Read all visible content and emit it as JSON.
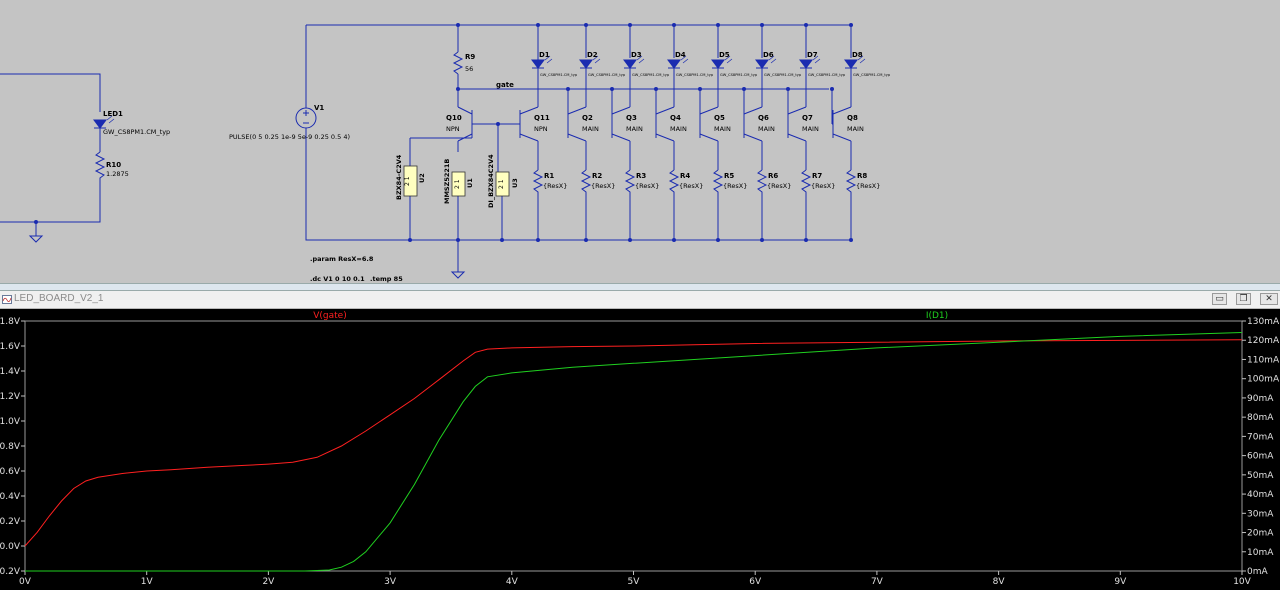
{
  "schematic": {
    "components": {
      "led1": {
        "ref": "LED1",
        "model": "GW_CS8PM1.CM_typ"
      },
      "r10": {
        "ref": "R10",
        "value": "1.2875"
      },
      "v1": {
        "ref": "V1",
        "value": "PULSE(0 5 0.25 1e-9 5e-9 0.25 0.5 4)"
      },
      "r9": {
        "ref": "R9",
        "value": "56"
      },
      "gate_label": "gate",
      "q10": {
        "ref": "Q10",
        "model": "NPN"
      },
      "q11": {
        "ref": "Q11",
        "model": "NPN"
      },
      "u2": {
        "ref": "U2",
        "model": "BZX84-C2V4",
        "pins": "2 1"
      },
      "u1": {
        "ref": "U1",
        "model": "MMSZ5221B",
        "pins": "2 1"
      },
      "u3": {
        "ref": "U3",
        "model": "DI_BZX84C2V4",
        "pins": "2 1"
      },
      "leds": [
        {
          "ref": "D1",
          "model": "GW_CS8PM1.CM_typ"
        },
        {
          "ref": "D2",
          "model": "GW_CS8PM1.CM_typ"
        },
        {
          "ref": "D3",
          "model": "GW_CS8PM1.CM_typ"
        },
        {
          "ref": "D4",
          "model": "GW_CS8PM1.CM_typ"
        },
        {
          "ref": "D5",
          "model": "GW_CS8PM1.CM_typ"
        },
        {
          "ref": "D6",
          "model": "GW_CS8PM1.CM_typ"
        },
        {
          "ref": "D7",
          "model": "GW_CS8PM1.CM_typ"
        },
        {
          "ref": "D8",
          "model": "GW_CS8PM1.CM_typ"
        }
      ],
      "transistors": [
        {
          "ref": "Q2",
          "model": "MAIN"
        },
        {
          "ref": "Q3",
          "model": "MAIN"
        },
        {
          "ref": "Q4",
          "model": "MAIN"
        },
        {
          "ref": "Q5",
          "model": "MAIN"
        },
        {
          "ref": "Q6",
          "model": "MAIN"
        },
        {
          "ref": "Q7",
          "model": "MAIN"
        },
        {
          "ref": "Q8",
          "model": "MAIN"
        }
      ],
      "resistors": [
        {
          "ref": "R1",
          "value": "{ResX}"
        },
        {
          "ref": "R2",
          "value": "{ResX}"
        },
        {
          "ref": "R3",
          "value": "{ResX}"
        },
        {
          "ref": "R4",
          "value": "{ResX}"
        },
        {
          "ref": "R5",
          "value": "{ResX}"
        },
        {
          "ref": "R6",
          "value": "{ResX}"
        },
        {
          "ref": "R7",
          "value": "{ResX}"
        },
        {
          "ref": "R8",
          "value": "{ResX}"
        }
      ]
    },
    "directives": {
      "param": ".param ResX=6.8",
      "dc": ".dc V1 0 10 0.1",
      "temp": ".temp 85"
    },
    "wire_color": "#1a2bb0"
  },
  "waveform_window": {
    "title": "LED_BOARD_V2_1",
    "buttons": {
      "minimize": "▭",
      "restore": "❐",
      "close": "✕"
    }
  },
  "chart_data": {
    "type": "line",
    "background": "#000000",
    "xlabel": "",
    "ylabel": "",
    "xlim": [
      0,
      10
    ],
    "x_ticks": [
      "0V",
      "1V",
      "2V",
      "3V",
      "4V",
      "5V",
      "6V",
      "7V",
      "8V",
      "9V",
      "10V"
    ],
    "ylim_left": [
      -0.2,
      1.8
    ],
    "y_ticks_left": [
      "1.8V",
      "1.6V",
      "1.4V",
      "1.2V",
      "1.0V",
      "0.8V",
      "0.6V",
      "0.4V",
      "0.2V",
      "0.0V",
      "-0.2V"
    ],
    "ylim_right": [
      0,
      130
    ],
    "y_ticks_right": [
      "130mA",
      "120mA",
      "110mA",
      "100mA",
      "90mA",
      "80mA",
      "70mA",
      "60mA",
      "50mA",
      "40mA",
      "30mA",
      "20mA",
      "10mA",
      "0mA"
    ],
    "grid": false,
    "series": [
      {
        "name": "V(gate)",
        "color": "#ff2020",
        "axis": "left",
        "x": [
          0,
          0.1,
          0.2,
          0.3,
          0.4,
          0.5,
          0.6,
          0.8,
          1.0,
          1.2,
          1.5,
          1.8,
          2.0,
          2.2,
          2.4,
          2.6,
          2.8,
          3.0,
          3.2,
          3.4,
          3.6,
          3.7,
          3.8,
          4.0,
          4.5,
          5.0,
          5.5,
          6.0,
          7.0,
          8.0,
          9.0,
          10.0
        ],
        "y": [
          0.0,
          0.11,
          0.24,
          0.36,
          0.46,
          0.52,
          0.55,
          0.58,
          0.6,
          0.61,
          0.63,
          0.645,
          0.655,
          0.67,
          0.71,
          0.8,
          0.92,
          1.05,
          1.18,
          1.33,
          1.48,
          1.55,
          1.575,
          1.585,
          1.595,
          1.6,
          1.61,
          1.62,
          1.63,
          1.64,
          1.645,
          1.65
        ]
      },
      {
        "name": "I(D1)",
        "color": "#20d020",
        "axis": "right",
        "x": [
          0,
          1.0,
          2.0,
          2.3,
          2.5,
          2.6,
          2.7,
          2.8,
          3.0,
          3.2,
          3.4,
          3.6,
          3.7,
          3.8,
          4.0,
          4.5,
          5.0,
          6.0,
          7.0,
          8.0,
          9.0,
          10.0
        ],
        "y": [
          0,
          0,
          0,
          0,
          0.5,
          2,
          5,
          10,
          25,
          45,
          68,
          88,
          96,
          101,
          103,
          106,
          108,
          112,
          116,
          119,
          122,
          124
        ]
      }
    ]
  }
}
